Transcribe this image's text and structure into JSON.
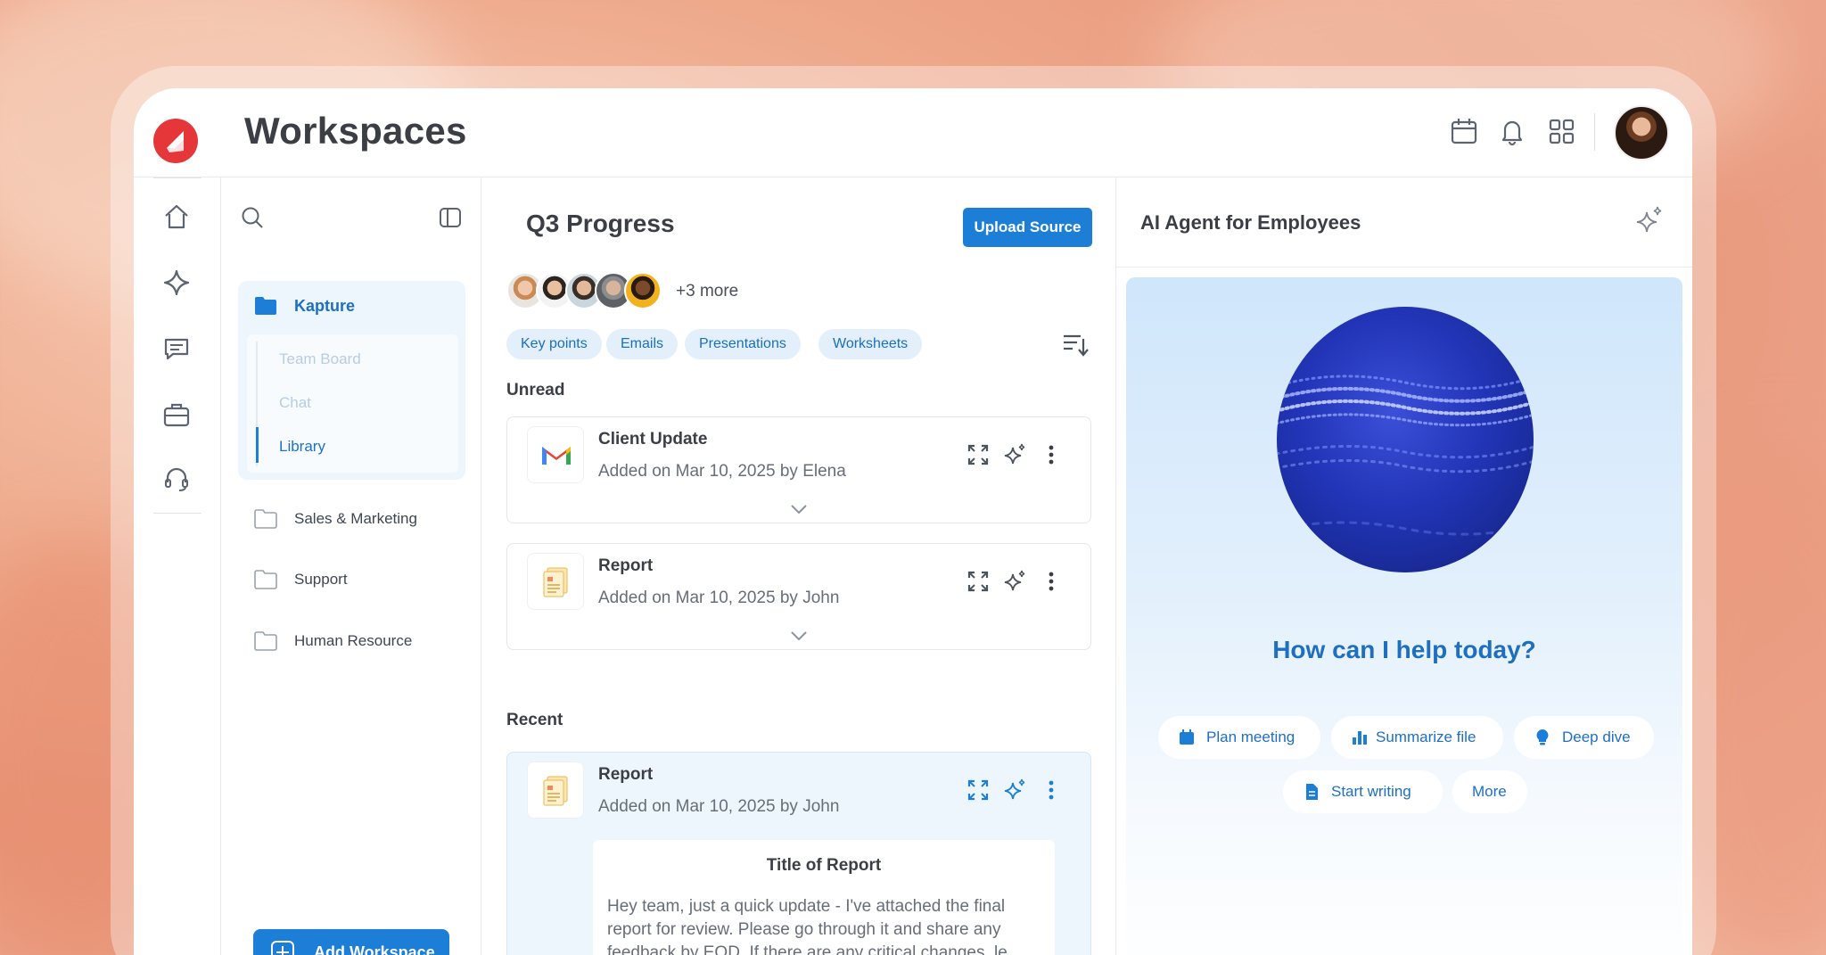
{
  "app": {
    "title": "Workspaces"
  },
  "header": {
    "icons": [
      "calendar-icon",
      "bell-icon",
      "apps-grid-icon"
    ],
    "avatar": "user-avatar"
  },
  "rail": {
    "items": [
      "home-icon",
      "sparkle-icon",
      "chat-icon",
      "briefcase-icon",
      "headset-icon"
    ]
  },
  "workspaces": {
    "active": {
      "label": "Kapture",
      "children": [
        {
          "label": "Team Board"
        },
        {
          "label": "Chat"
        },
        {
          "label": "Library"
        }
      ],
      "selected_child": "Library"
    },
    "items": [
      {
        "label": "Sales & Marketing"
      },
      {
        "label": "Support"
      },
      {
        "label": "Human Resource"
      }
    ],
    "add_label": "Add Workspace"
  },
  "center": {
    "title": "Q3 Progress",
    "upload_label": "Upload Source",
    "more_people": "+3 more",
    "chips": [
      {
        "label": "Key points"
      },
      {
        "label": "Emails"
      },
      {
        "label": "Presentations"
      },
      {
        "label": "Worksheets"
      }
    ],
    "unread_label": "Unread",
    "recent_label": "Recent",
    "unread": [
      {
        "title": "Client Update",
        "subtitle": "Added on Mar 10, 2025 by Elena",
        "icon": "gmail-icon"
      },
      {
        "title": "Report",
        "subtitle": "Added on Mar 10, 2025 by John",
        "icon": "report-icon"
      }
    ],
    "recent": [
      {
        "title": "Report",
        "subtitle": "Added on Mar 10, 2025 by John",
        "icon": "report-icon",
        "preview_title": "Title of Report",
        "preview_body": "Hey team, just a quick update - I've attached the final report for review. Please go through it and share any feedback by EOD. If there are any critical changes, le"
      }
    ]
  },
  "ai": {
    "title": "AI Agent for Employees",
    "prompt": "How can I help today?",
    "actions": [
      {
        "label": "Plan meeting",
        "icon": "calendar-icon"
      },
      {
        "label": "Summarize file",
        "icon": "bar-chart-icon"
      },
      {
        "label": "Deep dive",
        "icon": "lightbulb-icon"
      },
      {
        "label": "Start writing",
        "icon": "document-icon"
      },
      {
        "label": "More",
        "icon": ""
      }
    ]
  },
  "colors": {
    "accent": "#1c7ed6",
    "brand": "#e5373a",
    "text": "#3b3f45"
  }
}
